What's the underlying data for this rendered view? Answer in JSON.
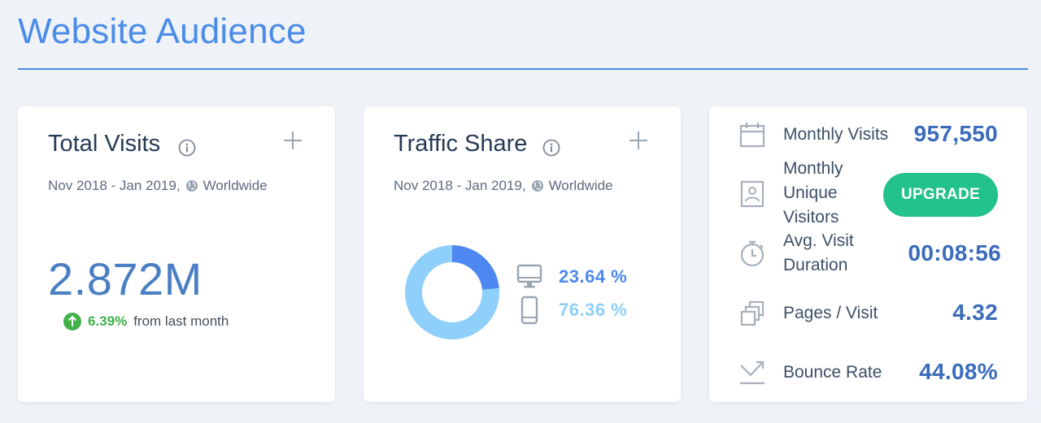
{
  "page": {
    "title": "Website Audience"
  },
  "total_visits": {
    "title": "Total Visits",
    "date_range": "Nov 2018 - Jan 2019,",
    "region": "Worldwide",
    "value": "2.872M",
    "change_pct": "6.39%",
    "change_text": "from last month",
    "change_direction": "up",
    "icons": [
      "info-icon",
      "plus-icon",
      "globe-icon",
      "up-arrow-icon"
    ]
  },
  "traffic_share": {
    "title": "Traffic Share",
    "date_range": "Nov 2018 - Jan 2019,",
    "region": "Worldwide",
    "desktop_pct_label": "23.64 %",
    "mobile_pct_label": "76.36 %",
    "desktop_share": 23.64,
    "mobile_share": 76.36,
    "colors": {
      "desktop": "#4c88f0",
      "mobile": "#8fcffb"
    },
    "icons": [
      "desktop-icon",
      "mobile-icon"
    ]
  },
  "metrics": {
    "monthly_visits": {
      "label": "Monthly Visits",
      "value": "957,550",
      "icon": "calendar-icon"
    },
    "unique_visitors": {
      "label_lines": [
        "Monthly",
        "Unique",
        "Visitors"
      ],
      "button": "UPGRADE",
      "icon": "id-card-icon"
    },
    "visit_duration": {
      "label_lines": [
        "Avg. Visit",
        "Duration"
      ],
      "value": "00:08:56",
      "icon": "stopwatch-icon"
    },
    "pages_per_visit": {
      "label": "Pages / Visit",
      "value": "4.32",
      "icon": "pages-icon"
    },
    "bounce_rate": {
      "label": "Bounce Rate",
      "value": "44.08%",
      "icon": "bounce-arrow-icon"
    }
  },
  "colors": {
    "accent": "#4a8ce8",
    "value_blue": "#3a6cbb",
    "positive": "#41b14a",
    "upgrade": "#23c28b"
  }
}
